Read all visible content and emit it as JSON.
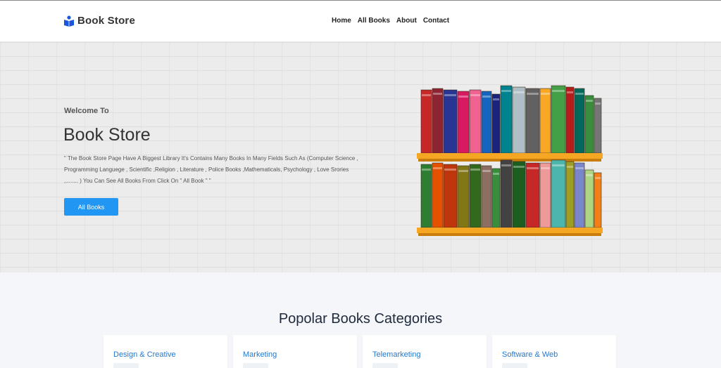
{
  "navbar": {
    "brand": "Book Store",
    "links": [
      "Home",
      "All Books",
      "About",
      "Contact"
    ]
  },
  "hero": {
    "welcome": "Welcome To",
    "title": "Book Store",
    "description": "\" The Book Store Page Have A Biggest Library It's Contains Many Books In Many Fields Such As (Computer Science , Programming Languege , Scientific ,Religion , Literature , Police Books ,Mathematicals, Psychology , Love Srories ,........ ) You Can See All Books From Click On \" All Book \" \"",
    "button": "All Books"
  },
  "shelf": {
    "top_books": [
      {
        "color": "#c62828",
        "title": "The Heart"
      },
      {
        "color": "#8e2432",
        "title": ""
      },
      {
        "color": "#283593",
        "title": "CHARTS LOVE"
      },
      {
        "color": "#d81b60",
        "title": "500"
      },
      {
        "color": "#f06292",
        "title": "Reading Experiments"
      },
      {
        "color": "#1565c0",
        "title": "Chemistry"
      },
      {
        "color": "#1a237e",
        "title": ""
      },
      {
        "color": "#00838f",
        "title": ""
      },
      {
        "color": "#b0bec5",
        "title": ""
      },
      {
        "color": "#616161",
        "title": "THE BLACK TEMPLE"
      },
      {
        "color": "#f9a825",
        "title": "Willow"
      },
      {
        "color": "#43a047",
        "title": ""
      },
      {
        "color": "#b71c1c",
        "title": ""
      },
      {
        "color": "#00695c",
        "title": "FRENCH ENGLISH"
      },
      {
        "color": "#388e3c",
        "title": ""
      },
      {
        "color": "#757575",
        "title": ""
      }
    ],
    "bottom_books": [
      {
        "color": "#2e7d32",
        "title": "DICTIONARY"
      },
      {
        "color": "#e65100",
        "title": "COOKING"
      },
      {
        "color": "#bf360c",
        "title": ""
      },
      {
        "color": "#827717",
        "title": ""
      },
      {
        "color": "#33691e",
        "title": ""
      },
      {
        "color": "#8d6e63",
        "title": ""
      },
      {
        "color": "#388e3c",
        "title": ""
      },
      {
        "color": "#424242",
        "title": ""
      },
      {
        "color": "#1b5e20",
        "title": ""
      },
      {
        "color": "#c62828",
        "title": "RED ROADS"
      },
      {
        "color": "#ef9a9a",
        "title": ""
      },
      {
        "color": "#4db6ac",
        "title": ""
      },
      {
        "color": "#9e9d24",
        "title": ""
      },
      {
        "color": "#7986cb",
        "title": ""
      },
      {
        "color": "#aed581",
        "title": "My Little Rainbow"
      },
      {
        "color": "#f57f17",
        "title": "TRAVEL"
      }
    ]
  },
  "categories": {
    "heading": "Popolar Books Categories",
    "items": [
      {
        "label": "Design & Creative"
      },
      {
        "label": "Marketing"
      },
      {
        "label": "Telemarketing"
      },
      {
        "label": "Software & Web"
      }
    ]
  },
  "colors": {
    "accent": "#2196f3",
    "link": "#2179d1",
    "brand_icon": "#1a56db"
  }
}
